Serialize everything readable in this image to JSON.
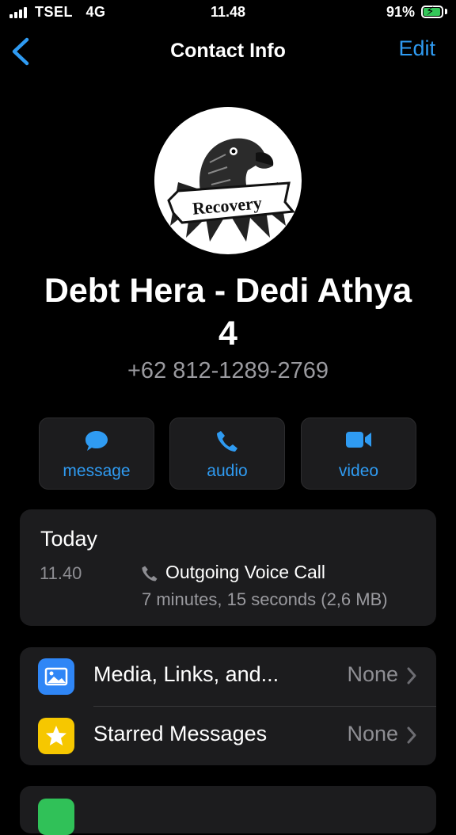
{
  "status_bar": {
    "carrier": "TSEL",
    "network": "4G",
    "time": "11.48",
    "battery": "91%",
    "battery_level": 0.91
  },
  "nav": {
    "title": "Contact Info",
    "edit_label": "Edit"
  },
  "profile": {
    "avatar_text": "Recovery",
    "name": "Debt Hera - Dedi Athya 4",
    "phone": "+62 812-1289-2769"
  },
  "actions": [
    {
      "label": "message",
      "icon": "message-icon"
    },
    {
      "label": "audio",
      "icon": "phone-icon"
    },
    {
      "label": "video",
      "icon": "video-icon"
    }
  ],
  "call_log": {
    "title": "Today",
    "time": "11.40",
    "type": "Outgoing Voice Call",
    "detail": "7 minutes, 15 seconds (2,6 MB)"
  },
  "rows": [
    {
      "label": "Media, Links, and...",
      "value": "None",
      "icon": "photo-icon",
      "color": "#2f86f6"
    },
    {
      "label": "Starred Messages",
      "value": "None",
      "icon": "star-icon",
      "color": "#f6c700"
    }
  ],
  "partial_row": {
    "icon": "speaker-icon",
    "color": "#30c158"
  },
  "colors": {
    "accent": "#2f9bf2",
    "card": "#1c1c1e",
    "background": "#000000",
    "battery_fill": "#34c759"
  }
}
